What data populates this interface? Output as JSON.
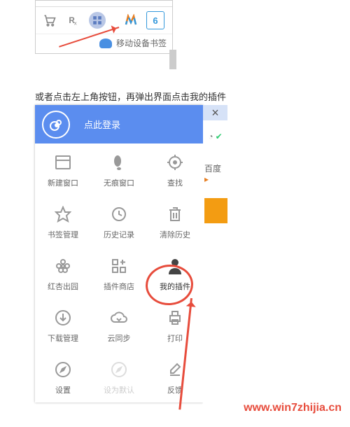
{
  "toolbar": {
    "bookmark_sync_label": "移动设备书签"
  },
  "instruction_text": "或者点击左上角按钮，再弹出界面点击我的插件",
  "panel": {
    "login_prompt": "点此登录",
    "close_glyph": "×"
  },
  "menu": [
    {
      "name": "new-window",
      "label": "新建窗口"
    },
    {
      "name": "incognito",
      "label": "无痕窗口"
    },
    {
      "name": "find",
      "label": "查找"
    },
    {
      "name": "bookmarks",
      "label": "书签管理"
    },
    {
      "name": "history",
      "label": "历史记录"
    },
    {
      "name": "clear-history",
      "label": "清除历史"
    },
    {
      "name": "red-apricot",
      "label": "红杏出园"
    },
    {
      "name": "plugin-store",
      "label": "插件商店"
    },
    {
      "name": "my-plugins",
      "label": "我的插件"
    },
    {
      "name": "downloads",
      "label": "下载管理"
    },
    {
      "name": "cloud-sync",
      "label": "云同步"
    },
    {
      "name": "print",
      "label": "打印"
    },
    {
      "name": "settings",
      "label": "设置"
    },
    {
      "name": "set-default",
      "label": "设为默认",
      "disabled": true
    },
    {
      "name": "feedback",
      "label": "反馈"
    }
  ],
  "right_strip": {
    "tab_text": "百度"
  },
  "watermark": "www.win7zhijia.cn"
}
